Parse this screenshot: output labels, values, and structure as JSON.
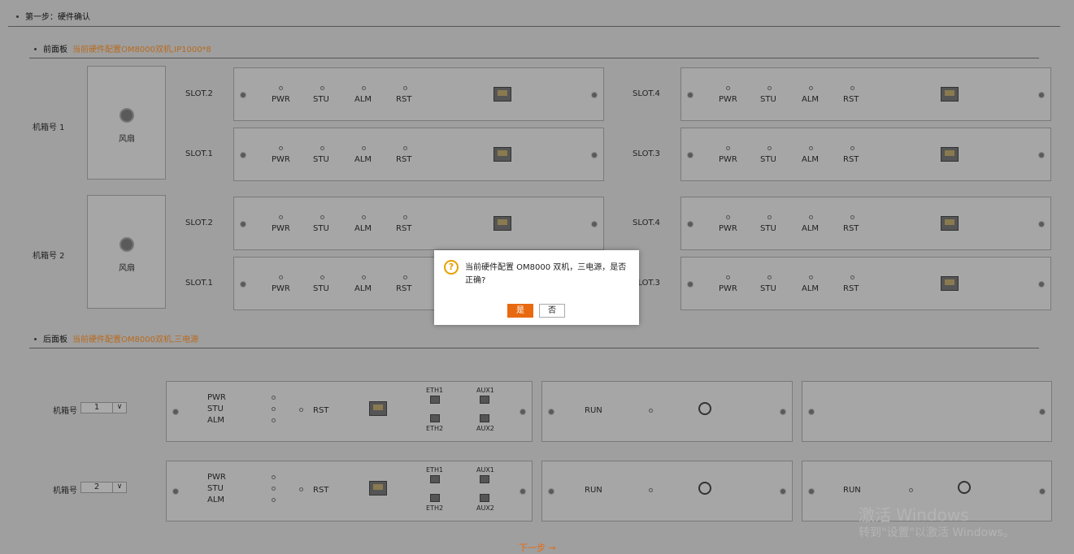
{
  "step_title": "第一步：硬件确认",
  "front_panel": {
    "title": "前面板",
    "config": "当前硬件配置OM8000双机,IP1000*8",
    "chassis": [
      {
        "label": "机箱号 1",
        "fan_label": "风扇"
      },
      {
        "label": "机箱号 2",
        "fan_label": "风扇"
      }
    ],
    "slots": [
      "SLOT.2",
      "SLOT.1",
      "SLOT.4",
      "SLOT.3"
    ],
    "leds": [
      "PWR",
      "STU",
      "ALM",
      "RST"
    ]
  },
  "back_panel": {
    "title": "后面板",
    "config": "当前硬件配置OM8000双机,三电源",
    "chassis_label": "机箱号",
    "chassis_values": [
      "1",
      "2"
    ],
    "dropdown_arrow": "∨",
    "main_leds": [
      "PWR",
      "STU",
      "ALM"
    ],
    "rst": "RST",
    "ports": [
      "ETH1",
      "AUX1",
      "ETH2",
      "AUX2"
    ],
    "run": "RUN"
  },
  "dialog": {
    "icon": "?",
    "message": "当前硬件配置 OM8000 双机，三电源，是否正确?",
    "yes": "是",
    "no": "否"
  },
  "next_label": "下一步 →",
  "watermark": {
    "line1": "激活 Windows",
    "line2": "转到\"设置\"以激活 Windows。"
  }
}
